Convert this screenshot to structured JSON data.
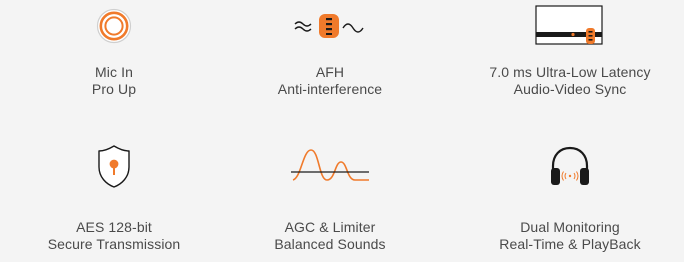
{
  "features": [
    {
      "line1": "Mic In",
      "line2": "Pro Up",
      "icon": "mic-in-ring-icon"
    },
    {
      "line1": "AFH",
      "line2": "Anti-interference",
      "icon": "anti-interference-mic-icon"
    },
    {
      "line1": "7.0 ms Ultra-Low Latency",
      "line2": "Audio-Video Sync",
      "icon": "low-latency-screen-icon"
    },
    {
      "line1": "AES 128-bit",
      "line2": "Secure Transmission",
      "icon": "shield-lock-icon"
    },
    {
      "line1": "AGC & Limiter",
      "line2": "Balanced Sounds",
      "icon": "sound-wave-limiter-icon"
    },
    {
      "line1": "Dual Monitoring",
      "line2": "Real-Time & PlayBack",
      "icon": "headphones-icon"
    }
  ],
  "colors": {
    "accent": "#f07a2b",
    "stroke": "#1a1a1a",
    "text": "#4a4a4a",
    "background": "#f4f4f4"
  }
}
